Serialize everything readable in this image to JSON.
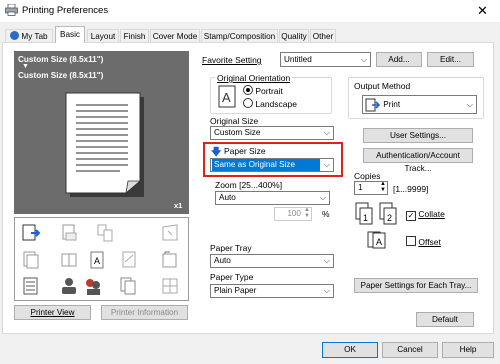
{
  "window": {
    "title": "Printing Preferences",
    "close_glyph": "✕"
  },
  "tabs": [
    {
      "label": "My Tab",
      "active": false
    },
    {
      "label": "Basic",
      "active": true
    },
    {
      "label": "Layout",
      "active": false
    },
    {
      "label": "Finish",
      "active": false
    },
    {
      "label": "Cover Mode",
      "active": false
    },
    {
      "label": "Stamp/Composition",
      "active": false
    },
    {
      "label": "Quality",
      "active": false
    },
    {
      "label": "Other",
      "active": false
    }
  ],
  "favorite": {
    "label": "Favorite Setting",
    "value": "Untitled",
    "add_label": "Add...",
    "edit_label": "Edit..."
  },
  "preview": {
    "line1": "Custom Size (8.5x11\")",
    "arrow": "▼",
    "line2": "Custom Size (8.5x11\")",
    "copies_tag": "x1"
  },
  "original_orientation": {
    "label": "Original Orientation",
    "portrait": "Portrait",
    "landscape": "Landscape",
    "selected": "portrait"
  },
  "original_size": {
    "label": "Original Size",
    "value": "Custom Size"
  },
  "paper_size": {
    "label": "Paper Size",
    "value": "Same as Original Size"
  },
  "zoom": {
    "label": "Zoom [25...400%]",
    "value": "Auto",
    "percent_value": "100",
    "unit": "%"
  },
  "paper_tray": {
    "label": "Paper Tray",
    "value": "Auto"
  },
  "paper_type": {
    "label": "Paper Type",
    "value": "Plain Paper"
  },
  "output_method": {
    "label": "Output Method",
    "value": "Print"
  },
  "buttons": {
    "user_settings": "User Settings...",
    "authentication": "Authentication/Account Track...",
    "paper_settings": "Paper Settings for Each Tray...",
    "default": "Default",
    "printer_view": "Printer View",
    "printer_information": "Printer Information",
    "ok": "OK",
    "cancel": "Cancel",
    "help": "Help"
  },
  "copies": {
    "label": "Copies",
    "value": "1",
    "range": "[1...9999]",
    "collate_label": "Collate",
    "collate_checked": true,
    "offset_label": "Offset",
    "offset_checked": false
  },
  "colors": {
    "highlight_red": "#e0201b",
    "selection_blue": "#0078d7",
    "arrow_blue": "#1f5fd0"
  }
}
